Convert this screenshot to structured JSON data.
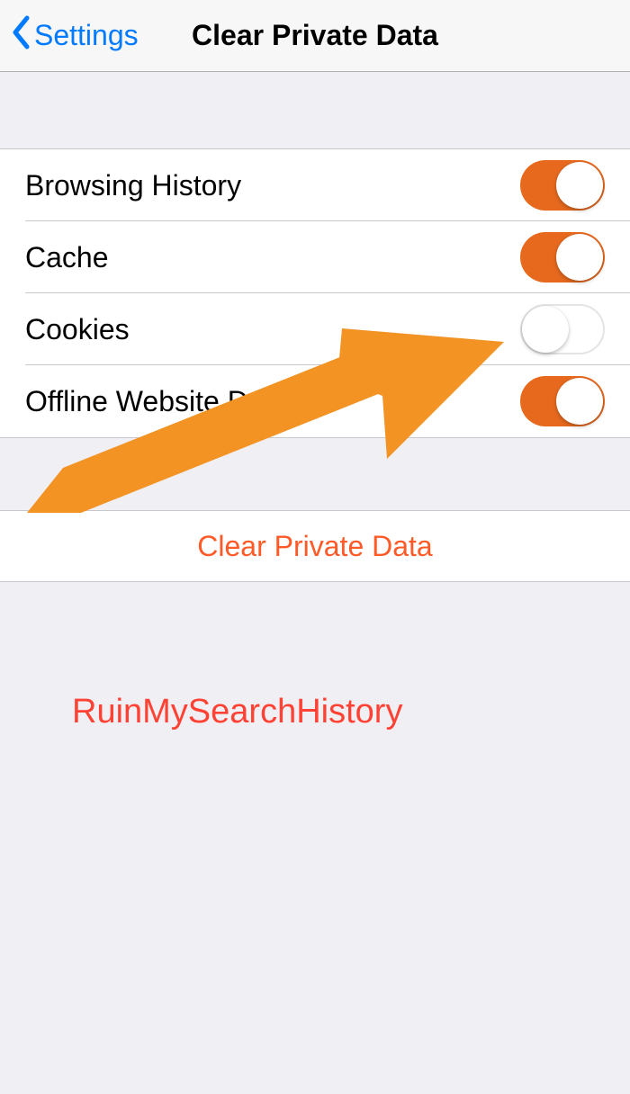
{
  "navbar": {
    "back_label": "Settings",
    "title": "Clear Private Data"
  },
  "options": [
    {
      "label": "Browsing History",
      "on": true
    },
    {
      "label": "Cache",
      "on": true
    },
    {
      "label": "Cookies",
      "on": false
    },
    {
      "label": "Offline Website Data",
      "on": true
    }
  ],
  "clear_button_label": "Clear Private Data",
  "watermark": "RuinMySearchHistory",
  "colors": {
    "accent_toggle": "#e6691e",
    "link_blue": "#007aff",
    "clear_red": "#ff5a27",
    "watermark_red": "#ff4233",
    "arrow_orange": "#f39323"
  }
}
